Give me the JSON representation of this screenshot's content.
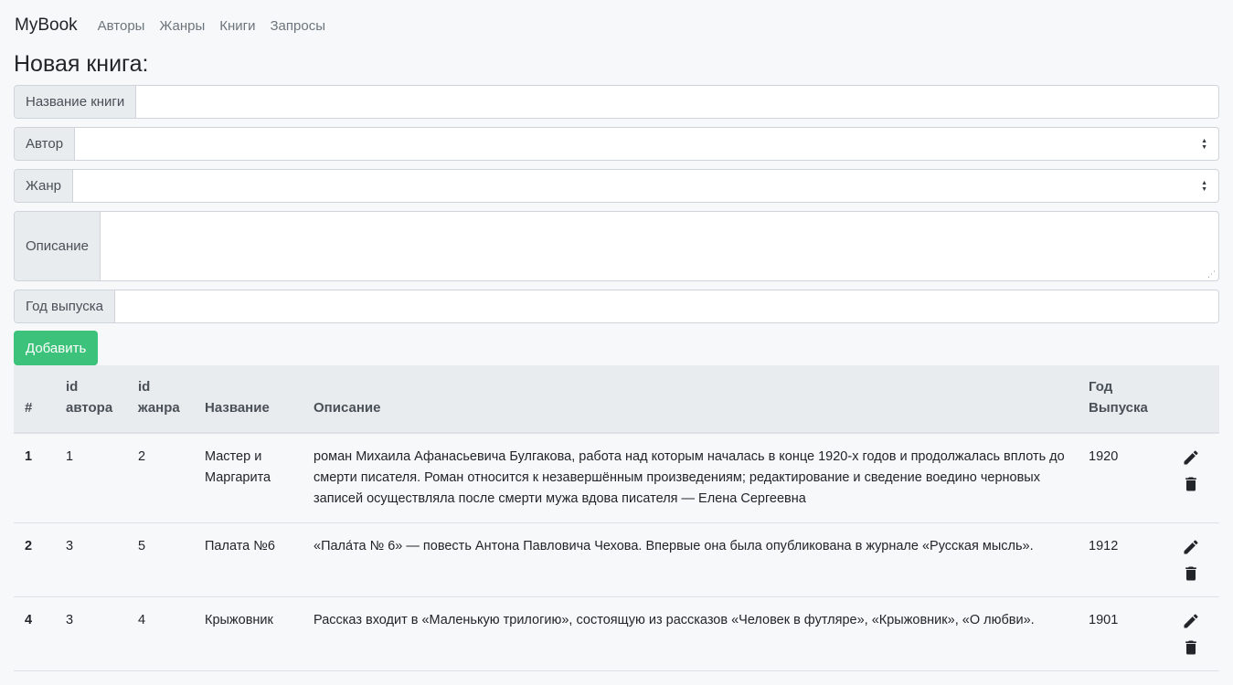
{
  "navbar": {
    "brand": "MyBook",
    "links": [
      "Авторы",
      "Жанры",
      "Книги",
      "Запросы"
    ]
  },
  "page_title": "Новая книга:",
  "form": {
    "title_label": "Название книги",
    "title_value": "",
    "author_label": "Автор",
    "author_selected": "",
    "genre_label": "Жанр",
    "genre_selected": "",
    "description_label": "Описание",
    "description_value": "",
    "year_label": "Год выпуска",
    "year_value": "",
    "submit_label": "Добавить"
  },
  "table": {
    "headers": {
      "num": "#",
      "author_id_line1": "id",
      "author_id_line2": "автора",
      "genre_id_line1": "id",
      "genre_id_line2": "жанра",
      "name": "Название",
      "description": "Описание",
      "year_line1": "Год",
      "year_line2": "Выпуска"
    },
    "rows": [
      {
        "num": "1",
        "author_id": "1",
        "genre_id": "2",
        "name": "Мастер и Маргарита",
        "description": "роман Михаила Афанасьевича Булгакова, работа над которым началась в конце 1920-х годов и продолжалась вплоть до смерти писателя. Роман относится к незавершённым произведениям; редактирование и сведение воедино черновых записей осуществляла после смерти мужа вдова писателя — Елена Сергеевна",
        "year": "1920"
      },
      {
        "num": "2",
        "author_id": "3",
        "genre_id": "5",
        "name": "Палата №6",
        "description": "«Пала́та № 6» — повесть Антона Павловича Чехова. Впервые она была опубликована в журнале «Русская мысль».",
        "year": "1912"
      },
      {
        "num": "4",
        "author_id": "3",
        "genre_id": "4",
        "name": "Крыжовник",
        "description": "Рассказ входит в «Маленькую трилогию», состоящую из рассказов «Человек в футляре», «Крыжовник», «О любви».",
        "year": "1901"
      }
    ]
  },
  "icons": {
    "edit": "pencil-icon",
    "delete": "trash-icon"
  },
  "colors": {
    "primary_button": "#3cc27a",
    "table_header_bg": "#e9ecef",
    "addon_bg": "#e9ecef"
  }
}
